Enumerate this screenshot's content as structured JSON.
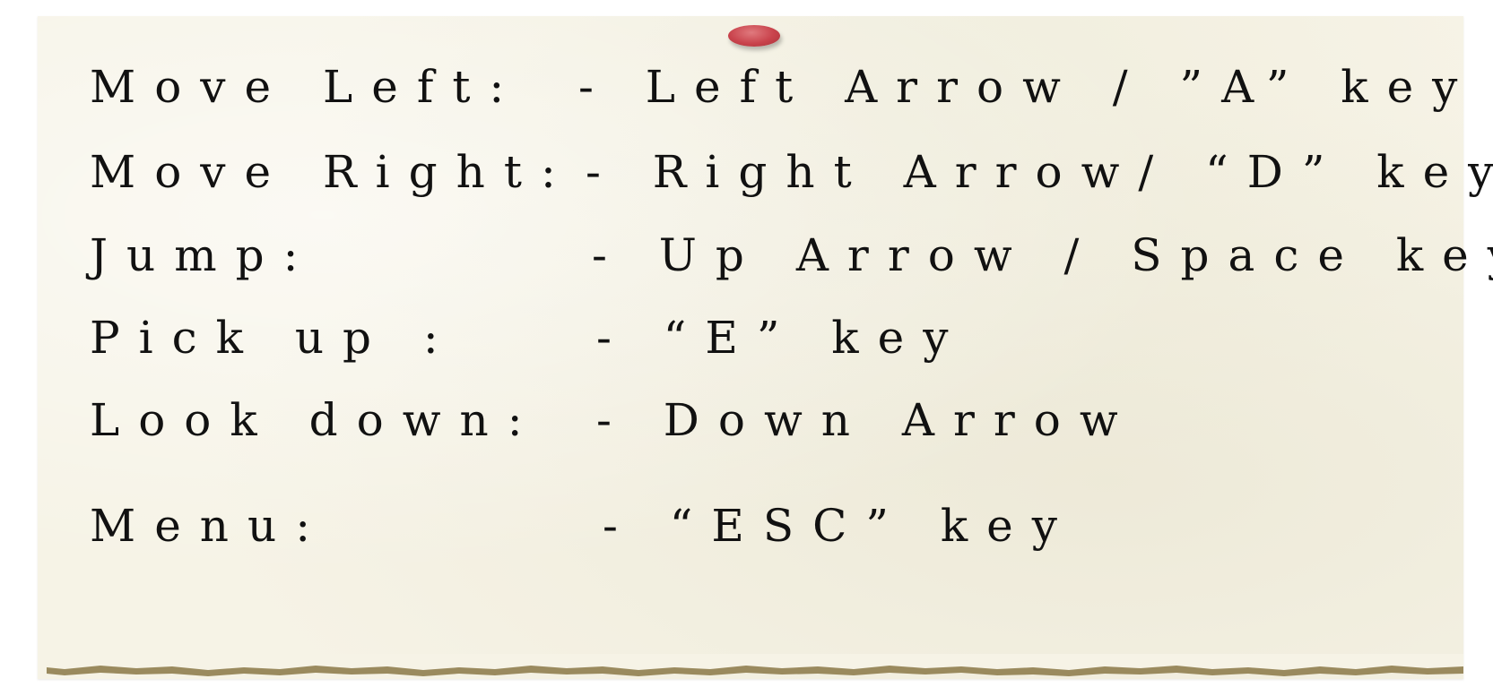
{
  "controls": [
    {
      "action": "Move Left:",
      "binding": "- Left Arrow / ”A” key"
    },
    {
      "action": "Move Right:",
      "binding": "- Right Arrow/ “D” key"
    },
    {
      "action": "Jump:",
      "binding": "- Up Arrow / Space key"
    },
    {
      "action": "Pick up :",
      "binding": "- “E” key"
    },
    {
      "action": "Look down:",
      "binding": "- Down Arrow"
    },
    {
      "action": "Menu:",
      "binding": "- “ESC” key"
    }
  ],
  "colors": {
    "paper": "#f6f3e6",
    "text": "#111111",
    "pin": "#c9434c",
    "torn_edge": "#9a8a5e"
  },
  "icons": {
    "pin": "pushpin-icon"
  }
}
